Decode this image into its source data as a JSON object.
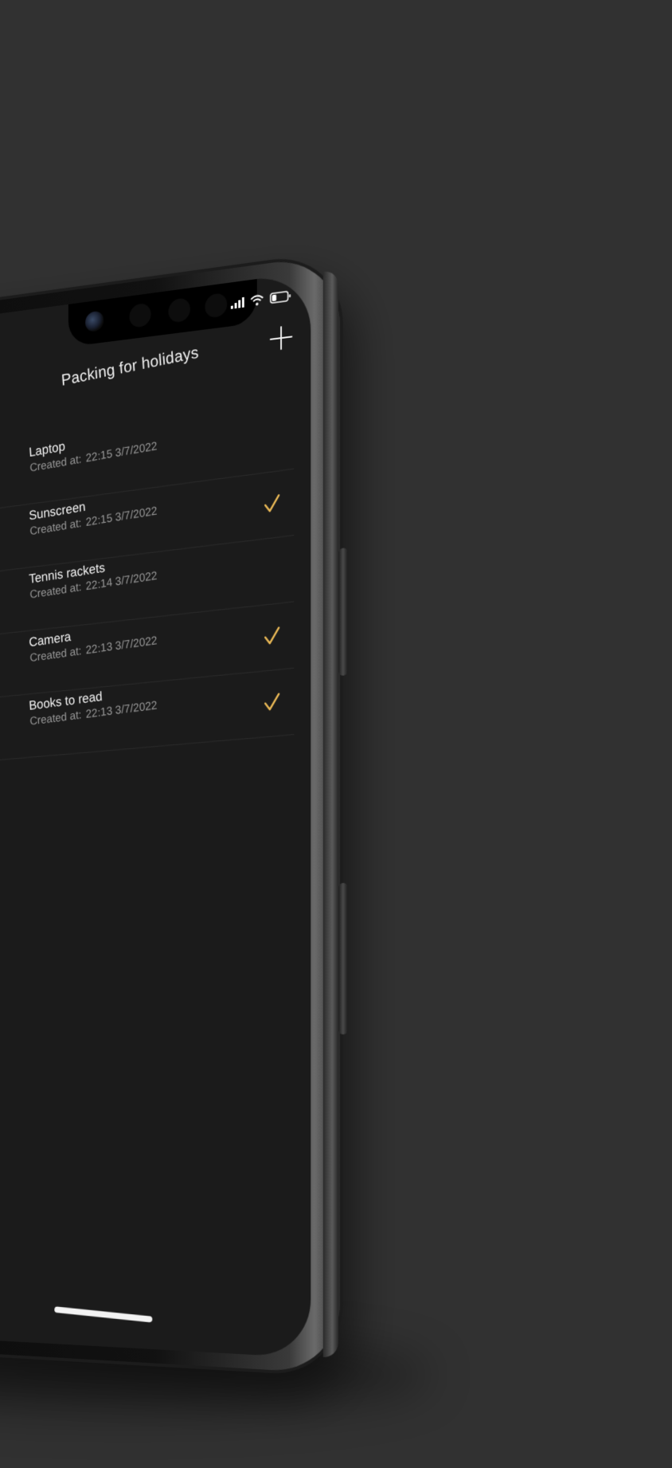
{
  "header": {
    "title": "Packing for holidays",
    "add_icon": "plus-icon"
  },
  "status_bar": {
    "icons": [
      "signal-icon",
      "wifi-icon",
      "battery-icon"
    ],
    "battery_level": 0.3
  },
  "items": [
    {
      "title": "Laptop",
      "meta_label": "Created at:",
      "created": "22:15 3/7/2022",
      "checked": false
    },
    {
      "title": "Sunscreen",
      "meta_label": "Created at:",
      "created": "22:15 3/7/2022",
      "checked": true
    },
    {
      "title": "Tennis rackets",
      "meta_label": "Created at:",
      "created": "22:14 3/7/2022",
      "checked": false
    },
    {
      "title": "Camera",
      "meta_label": "Created at:",
      "created": "22:13 3/7/2022",
      "checked": true
    },
    {
      "title": "Books to read",
      "meta_label": "Created at:",
      "created": "22:13 3/7/2022",
      "checked": true
    }
  ],
  "colors": {
    "background": "#313131",
    "screen": "#1b1b1b",
    "accent_check": "#e9b856",
    "text_primary": "#f4f4f4",
    "text_secondary": "#9a9a9a"
  }
}
